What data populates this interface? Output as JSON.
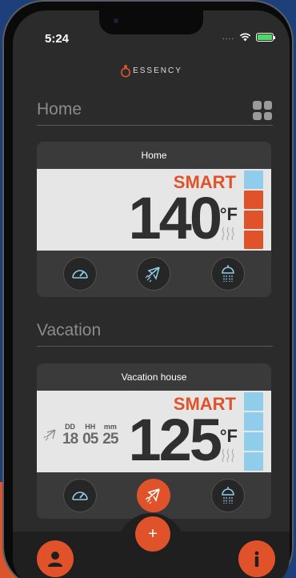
{
  "status": {
    "time": "5:24",
    "signal_dots": "...."
  },
  "brand": {
    "name": "ESSENCY"
  },
  "colors": {
    "accent": "#e0532a",
    "panel": "#e6e6e6",
    "bar_empty": "#8fcdea"
  },
  "sections": [
    {
      "title": "Home",
      "card": {
        "title": "Home",
        "mode": "SMART",
        "temperature": "140",
        "unit": "°F",
        "heat_level_bars": [
          "empty",
          "filled",
          "filled",
          "filled"
        ],
        "buttons": [
          "gauge-icon",
          "plane-icon",
          "shower-icon"
        ]
      }
    },
    {
      "title": "Vacation",
      "card": {
        "title": "Vacation house",
        "mode": "SMART",
        "temperature": "125",
        "unit": "°F",
        "heat_level_bars": [
          "empty",
          "empty",
          "empty",
          "empty"
        ],
        "countdown": {
          "labels": [
            "DD",
            "HH",
            "mm"
          ],
          "values": [
            "18",
            "05",
            "25"
          ]
        },
        "buttons": [
          "gauge-icon",
          "plane-icon",
          "shower-icon"
        ],
        "active_button": "plane-icon"
      }
    }
  ],
  "bottom_nav": {
    "add_label": "+",
    "info_label": "i"
  }
}
